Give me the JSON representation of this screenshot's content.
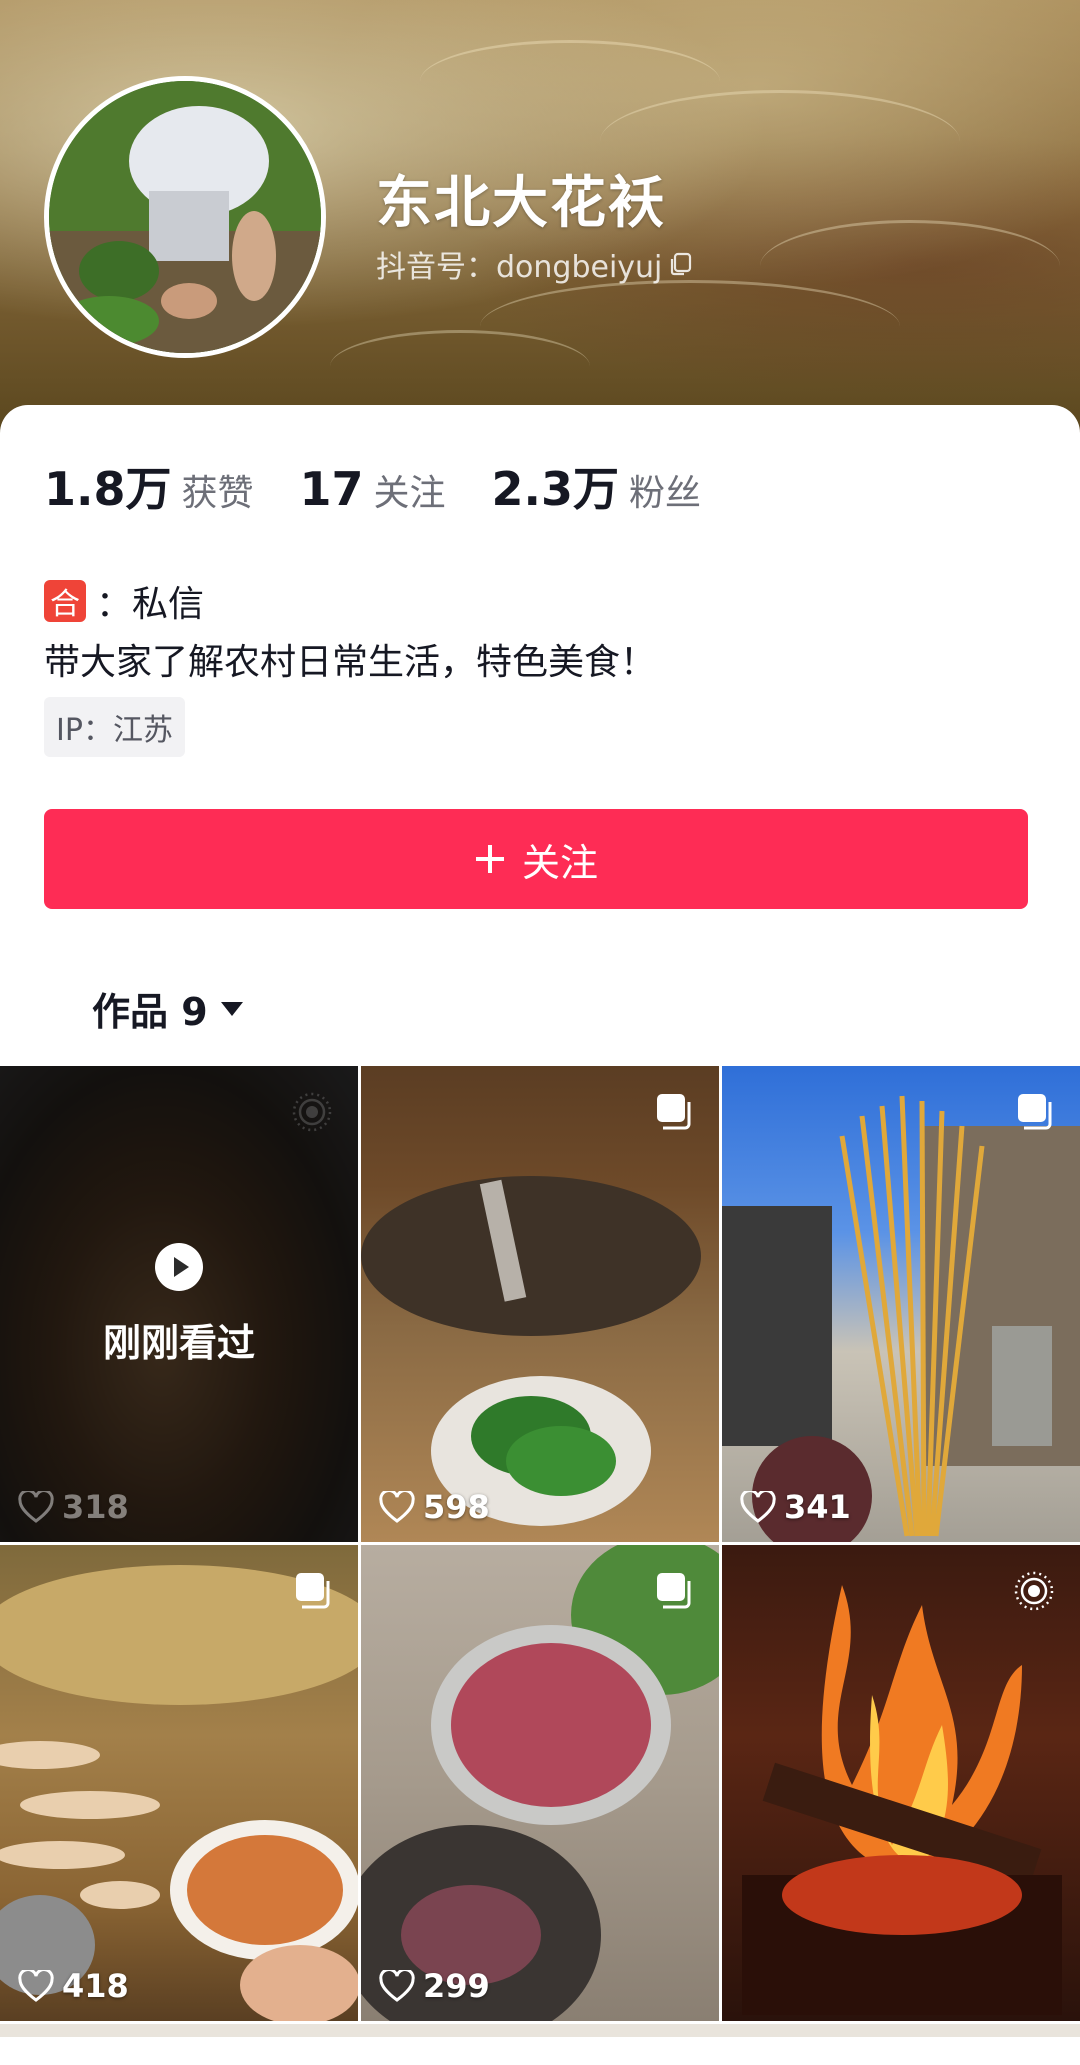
{
  "profile": {
    "display_name": "东北大花袄",
    "handle": "抖音号：dongbeiyuj"
  },
  "stats": [
    {
      "value": "1.8万",
      "label": "获赞"
    },
    {
      "value": "17",
      "label": "关注"
    },
    {
      "value": "2.3万",
      "label": "粉丝"
    }
  ],
  "collab": {
    "badge": "合",
    "text": "：私信"
  },
  "bio": "带大家了解农村日常生活，特色美食！",
  "ip": "IP：江苏",
  "follow_button": {
    "label": "关注"
  },
  "works_tab": {
    "label": "作品 9"
  },
  "videos": [
    {
      "likes": "318",
      "overlay": "刚刚看过",
      "icon": "live-photo-icon"
    },
    {
      "likes": "598",
      "icon": "multi-image-icon"
    },
    {
      "likes": "341",
      "icon": "multi-image-icon"
    },
    {
      "likes": "418",
      "icon": "multi-image-icon"
    },
    {
      "likes": "299",
      "icon": "multi-image-icon"
    },
    {
      "likes": "",
      "icon": "live-photo-icon"
    }
  ],
  "colors": {
    "accent": "#fe2c55",
    "badge": "#ef4438",
    "text": "#161823",
    "secondary": "#6d6f78"
  }
}
